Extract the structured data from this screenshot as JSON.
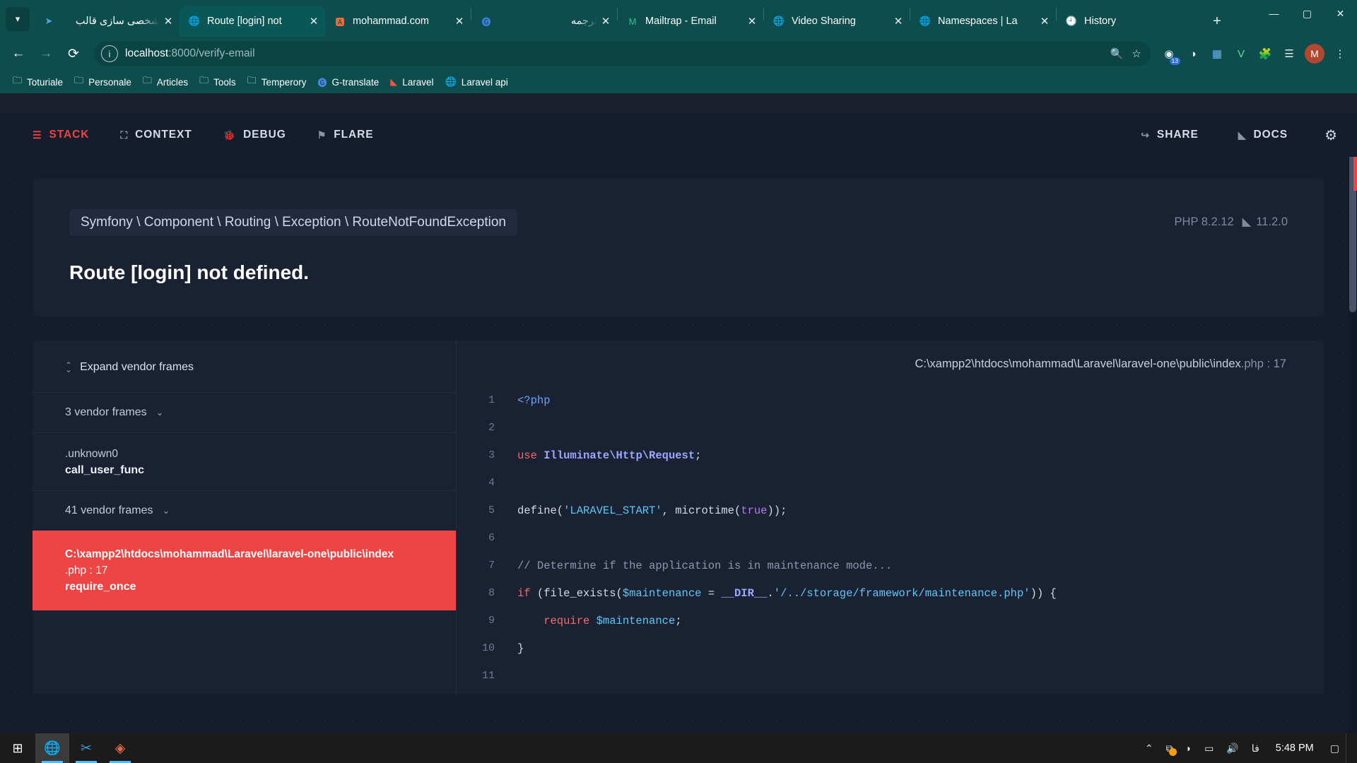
{
  "browser": {
    "tab_search_icon": "chevron-down-icon",
    "tabs": [
      {
        "title": "شخصی سازی قالب",
        "favicon": "telegram-icon",
        "rtl": true,
        "active": false
      },
      {
        "title": "Route [login] not",
        "favicon": "globe-icon",
        "rtl": false,
        "active": true
      },
      {
        "title": "mohammad.com",
        "favicon": "phpstorm-icon",
        "rtl": false,
        "active": false
      },
      {
        "title": "ترجمه",
        "favicon": "google-translate-icon",
        "rtl": true,
        "active": false
      },
      {
        "title": "Mailtrap - Email",
        "favicon": "mailtrap-icon",
        "rtl": false,
        "active": false
      },
      {
        "title": "Video Sharing",
        "favicon": "globe-icon",
        "rtl": false,
        "active": false
      },
      {
        "title": "Namespaces | La",
        "favicon": "globe-icon",
        "rtl": false,
        "active": false
      },
      {
        "title": "History",
        "favicon": "history-icon",
        "rtl": false,
        "active": false
      }
    ],
    "new_tab_label": "+",
    "window_controls": {
      "minimize": "—",
      "maximize": "▢",
      "close": "✕"
    },
    "nav": {
      "back": "←",
      "forward": "→",
      "reload": "⟳"
    },
    "omnibox": {
      "site_info_icon": "info-circle-icon",
      "url_host": "localhost",
      "url_path": ":8000/verify-email",
      "zoom_icon": "zoom-search-icon",
      "bookmark_icon": "star-icon"
    },
    "toolbar_icons": [
      {
        "name": "extensions-count-icon",
        "glyph": "◉",
        "badge": "13"
      },
      {
        "name": "profile-sync-icon",
        "glyph": "◑",
        "badge": ""
      },
      {
        "name": "analytics-extension-icon",
        "glyph": "▦",
        "badge": ""
      },
      {
        "name": "vue-devtools-icon",
        "glyph": "V",
        "badge": ""
      },
      {
        "name": "extensions-puzzle-icon",
        "glyph": "🧩",
        "badge": ""
      },
      {
        "name": "reading-list-icon",
        "glyph": "☰",
        "badge": ""
      }
    ],
    "avatar_initial": "M",
    "menu_icon": "vertical-dots-icon",
    "bookmarks": [
      {
        "label": "Toturiale",
        "icon": "folder-icon"
      },
      {
        "label": "Personale",
        "icon": "folder-icon"
      },
      {
        "label": "Articles",
        "icon": "folder-icon"
      },
      {
        "label": "Tools",
        "icon": "folder-icon"
      },
      {
        "label": "Temperory",
        "icon": "folder-icon"
      },
      {
        "label": "G-translate",
        "icon": "google-translate-icon"
      },
      {
        "label": "Laravel",
        "icon": "laravel-icon"
      },
      {
        "label": "Laravel api",
        "icon": "globe-icon"
      }
    ]
  },
  "flare": {
    "nav_left": [
      {
        "label": "STACK",
        "icon": "stack-lines-icon",
        "active": true
      },
      {
        "label": "CONTEXT",
        "icon": "context-brackets-icon",
        "active": false
      },
      {
        "label": "DEBUG",
        "icon": "bug-icon",
        "active": false
      },
      {
        "label": "FLARE",
        "icon": "flare-flag-icon",
        "active": false
      }
    ],
    "nav_right": [
      {
        "label": "SHARE",
        "icon": "share-arrow-icon"
      },
      {
        "label": "DOCS",
        "icon": "laravel-icon"
      }
    ],
    "settings_icon": "gear-icon",
    "accent_color": "#ef4444",
    "exception_class": "Symfony \\ Component \\ Routing \\ Exception \\ RouteNotFoundException",
    "exception_message": "Route [login] not defined.",
    "php_version": "PHP 8.2.12",
    "laravel_version": "11.2.0",
    "expand_vendor_frames": "Expand vendor frames",
    "frames": [
      {
        "type": "vendor",
        "label": "3 vendor frames",
        "chevron": "⌄"
      },
      {
        "type": "frame",
        "path": ".unknown0",
        "fn": "call_user_func",
        "selected": false
      },
      {
        "type": "vendor",
        "label": "41 vendor frames",
        "chevron": "⌄"
      },
      {
        "type": "frame",
        "path_bold": "C:\\xampp2\\htdocs\\mohammad\\Laravel\\laravel-one\\public\\index",
        "path_tail": ".php : 17",
        "fn": "require_once",
        "selected": true
      }
    ],
    "code_file_path": "C:\\xampp2\\htdocs\\mohammad\\Laravel\\laravel-one\\public\\index",
    "code_file_ext": ".php : 17",
    "code_lines": [
      {
        "n": "1",
        "tokens": [
          {
            "t": "<?php",
            "c": "c-tag"
          }
        ]
      },
      {
        "n": "2",
        "tokens": []
      },
      {
        "n": "3",
        "tokens": [
          {
            "t": "use ",
            "c": "c-kw"
          },
          {
            "t": "Illuminate\\Http\\Request",
            "c": "c-cls"
          },
          {
            "t": ";",
            "c": "c-fn"
          }
        ]
      },
      {
        "n": "4",
        "tokens": []
      },
      {
        "n": "5",
        "tokens": [
          {
            "t": "define(",
            "c": "c-fn"
          },
          {
            "t": "'LARAVEL_START'",
            "c": "c-str"
          },
          {
            "t": ", microtime(",
            "c": "c-fn"
          },
          {
            "t": "true",
            "c": "c-const"
          },
          {
            "t": "));",
            "c": "c-fn"
          }
        ]
      },
      {
        "n": "6",
        "tokens": []
      },
      {
        "n": "7",
        "tokens": [
          {
            "t": "// Determine if the application is in maintenance mode...",
            "c": "c-com"
          }
        ]
      },
      {
        "n": "8",
        "tokens": [
          {
            "t": "if ",
            "c": "c-kw"
          },
          {
            "t": "(file_exists(",
            "c": "c-fn"
          },
          {
            "t": "$maintenance",
            "c": "c-var"
          },
          {
            "t": " = ",
            "c": "c-fn"
          },
          {
            "t": "__DIR__",
            "c": "c-cls"
          },
          {
            "t": ".",
            "c": "c-fn"
          },
          {
            "t": "'/../storage/framework/maintenance.php'",
            "c": "c-str"
          },
          {
            "t": ")) {",
            "c": "c-fn"
          }
        ]
      },
      {
        "n": "9",
        "tokens": [
          {
            "t": "    require ",
            "c": "c-kw"
          },
          {
            "t": "$maintenance",
            "c": "c-var"
          },
          {
            "t": ";",
            "c": "c-fn"
          }
        ]
      },
      {
        "n": "10",
        "tokens": [
          {
            "t": "}",
            "c": "c-fn"
          }
        ]
      },
      {
        "n": "11",
        "tokens": []
      }
    ]
  },
  "taskbar": {
    "start_icon": "windows-start-icon",
    "apps": [
      {
        "name": "chrome-icon",
        "active": true
      },
      {
        "name": "vscode-icon",
        "active": false
      },
      {
        "name": "xampp-icon",
        "active": false
      }
    ],
    "tray": [
      {
        "name": "show-hidden-icons-chevron",
        "glyph": "⌃",
        "dot": false
      },
      {
        "name": "onedrive-sync-icon",
        "glyph": "⧉",
        "dot": true
      },
      {
        "name": "wifi-icon",
        "glyph": "◗",
        "dot": false
      },
      {
        "name": "battery-icon",
        "glyph": "▭",
        "dot": false
      },
      {
        "name": "volume-icon",
        "glyph": "🔊",
        "dot": false
      },
      {
        "name": "language-icon",
        "glyph": "فا",
        "dot": false
      }
    ],
    "clock": "5:48 PM",
    "notification_icon": "action-center-icon"
  }
}
